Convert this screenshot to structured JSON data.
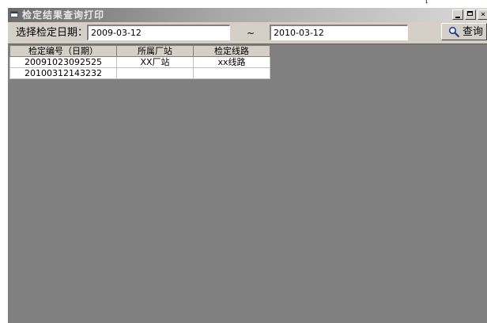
{
  "window": {
    "title": "检定结果查询打印"
  },
  "edge_mark": "[",
  "toolbar": {
    "date_label": "选择检定日期：",
    "date_from": "2009-03-12",
    "range_separator": "~",
    "date_to": "2010-03-12",
    "query_label": "查询"
  },
  "table": {
    "columns": [
      "检定编号（日期）",
      "所属厂站",
      "检定线路"
    ],
    "rows": [
      [
        "20091023092525",
        "XX厂站",
        "xx线路"
      ],
      [
        "20100312143232",
        "",
        ""
      ]
    ]
  },
  "colors": {
    "client_area": "#808080",
    "window_face": "#d4d0c8",
    "titlebar_inactive_start": "#6c6c6c"
  },
  "icons": [
    "window-icon",
    "minimize-icon",
    "maximize-icon",
    "close-icon",
    "search-icon"
  ]
}
